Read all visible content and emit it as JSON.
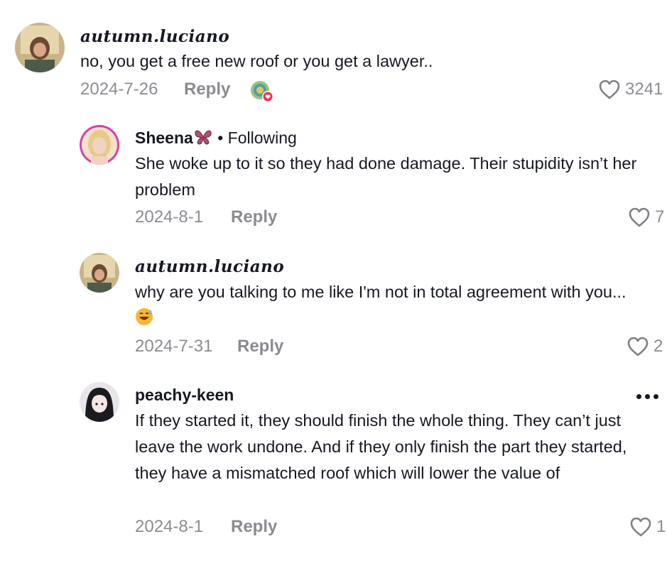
{
  "comments": [
    {
      "username": "autumn.luciano",
      "text": "no, you get a free new roof or you get a lawyer..",
      "date": "2024-7-26",
      "reply_label": "Reply",
      "likes": "3241"
    },
    {
      "username": "Sheena",
      "username_emoji": "butterfly-icon",
      "following_label": " • Following",
      "text": "She woke up to it so they had done damage. Their stupidity isn’t her problem",
      "date": "2024-8-1",
      "reply_label": "Reply",
      "likes": "7"
    },
    {
      "username": "autumn.luciano",
      "text": "why are you talking to me like I'm not in total agreement with you...",
      "text_emoji": "grinning-sweat-emoji",
      "date": "2024-7-31",
      "reply_label": "Reply",
      "likes": "2"
    },
    {
      "username": "peachy-keen",
      "text": "If they started it, they should finish the whole thing. They can’t just leave the work undone. And if they only finish the part they started, they have a mismatched roof which will lower the value of",
      "date": "2024-8-1",
      "reply_label": "Reply",
      "likes": "1"
    }
  ],
  "colors": {
    "text": "#161823",
    "muted": "rgba(22,24,35,0.5)",
    "creator_like_badge": "#fe2c55"
  }
}
